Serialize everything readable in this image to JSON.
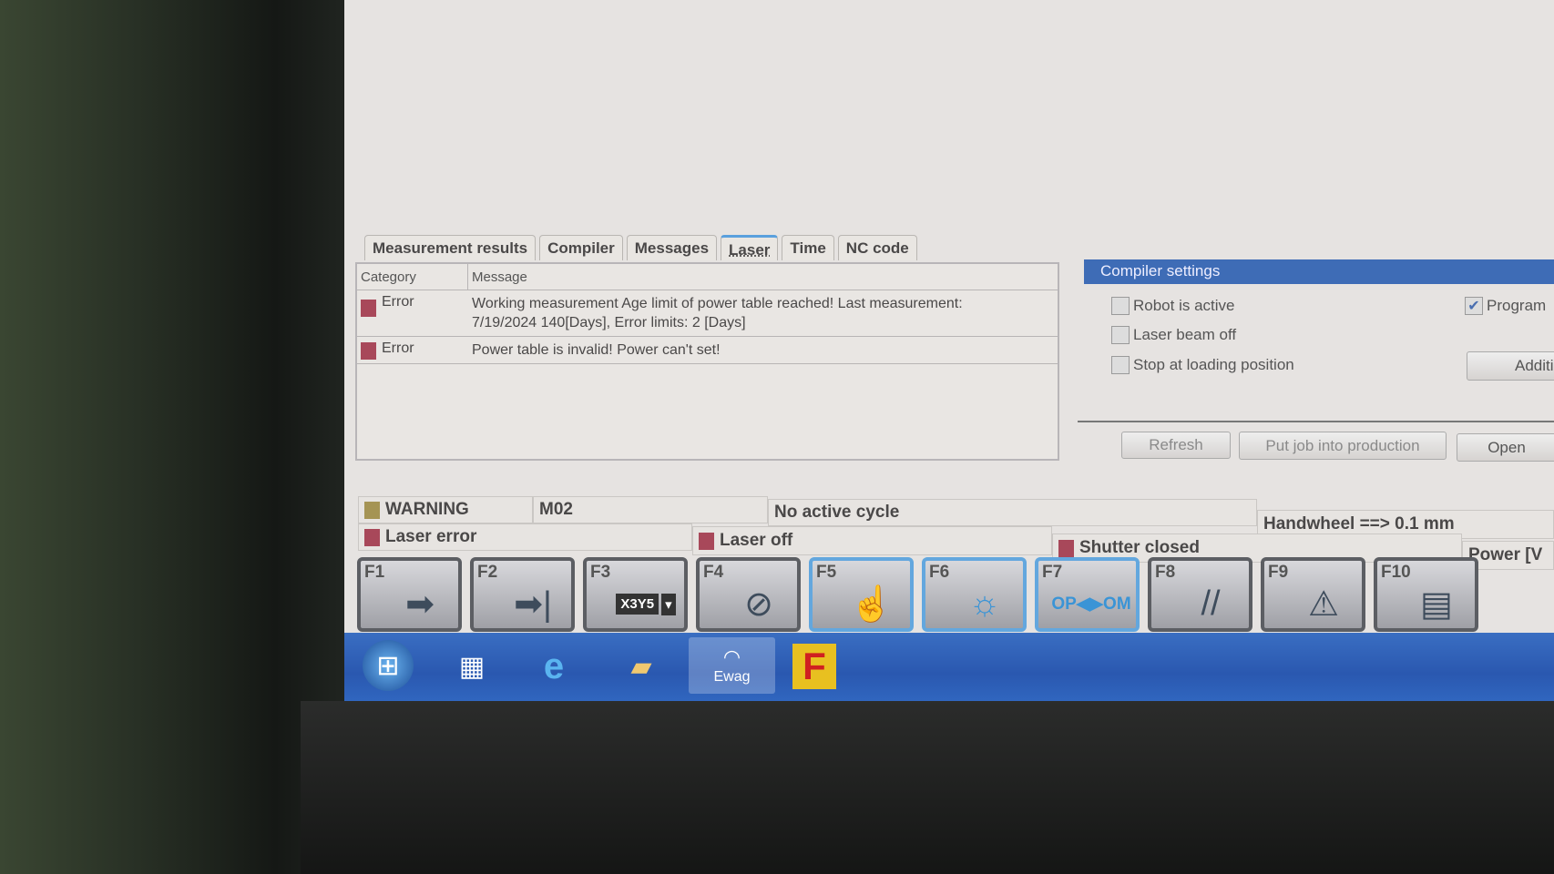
{
  "tabs": [
    {
      "label": "Measurement results"
    },
    {
      "label": "Compiler"
    },
    {
      "label": "Messages"
    },
    {
      "label": "Laser",
      "active": true
    },
    {
      "label": "Time"
    },
    {
      "label": "NC code"
    }
  ],
  "messages": {
    "columns": [
      "Category",
      "Message"
    ],
    "rows": [
      {
        "category": "Error",
        "message": "Working measurement Age limit of power table reached! Last measurement:",
        "message2": "7/19/2024 140[Days], Error limits: 2 [Days]"
      },
      {
        "category": "Error",
        "message": "Power table is invalid! Power can't set!"
      }
    ]
  },
  "compiler_settings": {
    "title": "Compiler settings",
    "robot_active": {
      "label": "Robot is active",
      "checked": false
    },
    "laser_beam_off": {
      "label": "Laser beam off",
      "checked": false
    },
    "stop_loading": {
      "label": "Stop at loading position",
      "checked": false
    },
    "program": {
      "label": "Program",
      "checked": true
    },
    "additional_label": "Additio",
    "refresh_label": "Refresh",
    "put_job_label": "Put job into production",
    "open_label": "Open"
  },
  "status": {
    "warning": "WARNING",
    "code": "M02",
    "cycle": "No active cycle",
    "handwheel": "Handwheel ==> 0.1 mm",
    "laser_error": "Laser error",
    "laser_off": "Laser off",
    "shutter": "Shutter closed",
    "power": "Power [V"
  },
  "fkeys": [
    {
      "label": "F1",
      "icon": "arrow-right-icon"
    },
    {
      "label": "F2",
      "icon": "arrow-to-end-icon"
    },
    {
      "label": "F3",
      "icon": "axis-select-icon",
      "text": "X3Y5"
    },
    {
      "label": "F4",
      "icon": "rotate-icon"
    },
    {
      "label": "F5",
      "icon": "hand-pointer-icon"
    },
    {
      "label": "F6",
      "icon": "lightbulb-icon"
    },
    {
      "label": "F7",
      "icon": "op-om-icon",
      "text": "OP◀▶OM"
    },
    {
      "label": "F8",
      "icon": "parallel-lines-icon"
    },
    {
      "label": "F9",
      "icon": "laser-warning-icon"
    },
    {
      "label": "F10",
      "icon": "document-icon"
    }
  ],
  "taskbar": {
    "ewag_label": "Ewag"
  },
  "colors": {
    "error": "#a8485a",
    "warning": "#a59454",
    "header": "#3e6cb6",
    "taskbar": "#2a58b0",
    "fkey_active": "#63a7de"
  }
}
